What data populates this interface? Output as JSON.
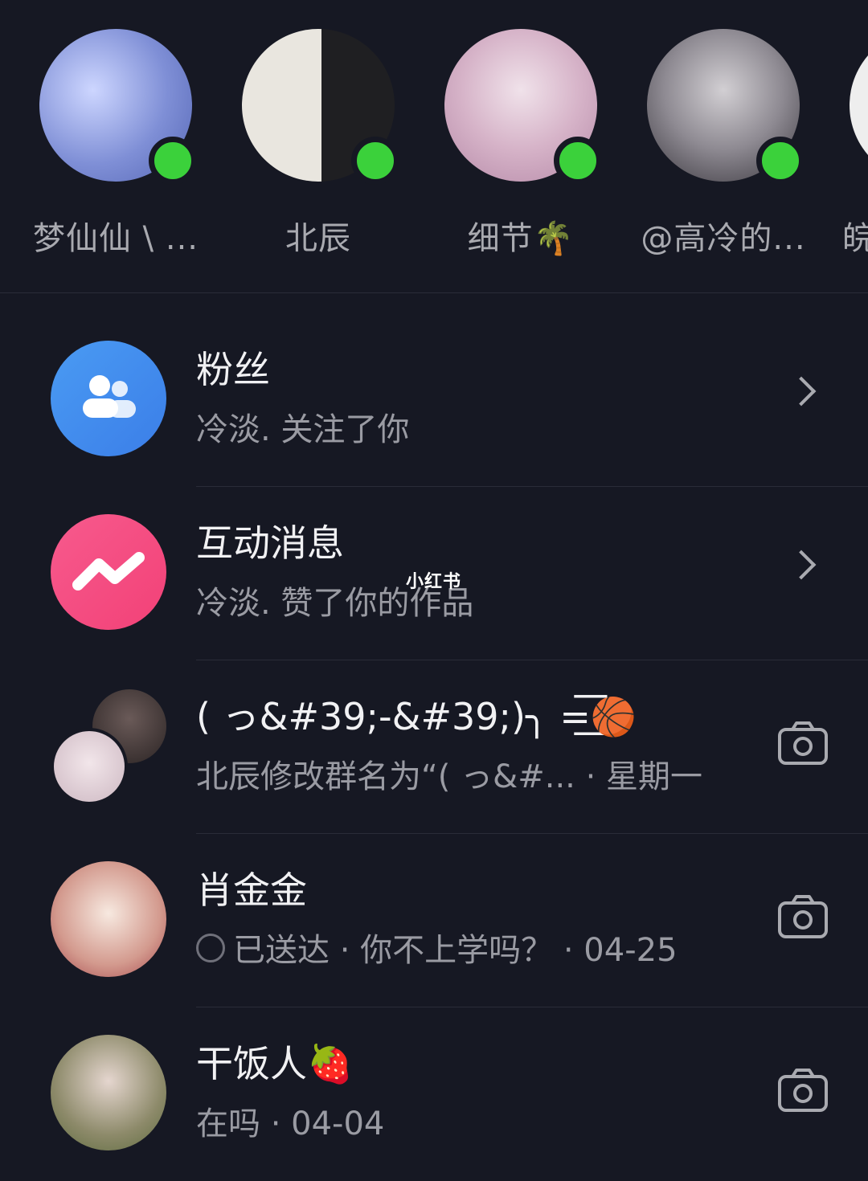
{
  "friends": [
    {
      "name": "梦仙仙 \\ ...",
      "online": true
    },
    {
      "name": "北辰",
      "online": true
    },
    {
      "name": "细节🌴",
      "online": true
    },
    {
      "name": "@高冷的...",
      "online": true
    },
    {
      "name": "皖",
      "online": false
    }
  ],
  "system": [
    {
      "title": "粉丝",
      "subtitle": "冷淡. 关注了你",
      "icon": "people-icon"
    },
    {
      "title": "互动消息",
      "subtitle": "冷淡. 赞了你的作品",
      "icon": "zigzag-icon"
    }
  ],
  "watermark": "小红书",
  "chats": [
    {
      "title": "( っ&#39;-&#39;)╮ =͟͟͞͞🏀",
      "subtitle": "北辰修改群名为“( っ&#... · 星期一",
      "type": "group"
    },
    {
      "title": "肖金金",
      "status": "已送达",
      "subtitle": "· 你不上学吗？ · 04-25",
      "type": "single"
    },
    {
      "title": "干饭人🍓",
      "subtitle": "在吗 · 04-04",
      "type": "single"
    }
  ],
  "colors": {
    "background": "#161823",
    "online": "#3bd13b",
    "fans": "#4a9bf3",
    "interact": "#f24177"
  }
}
